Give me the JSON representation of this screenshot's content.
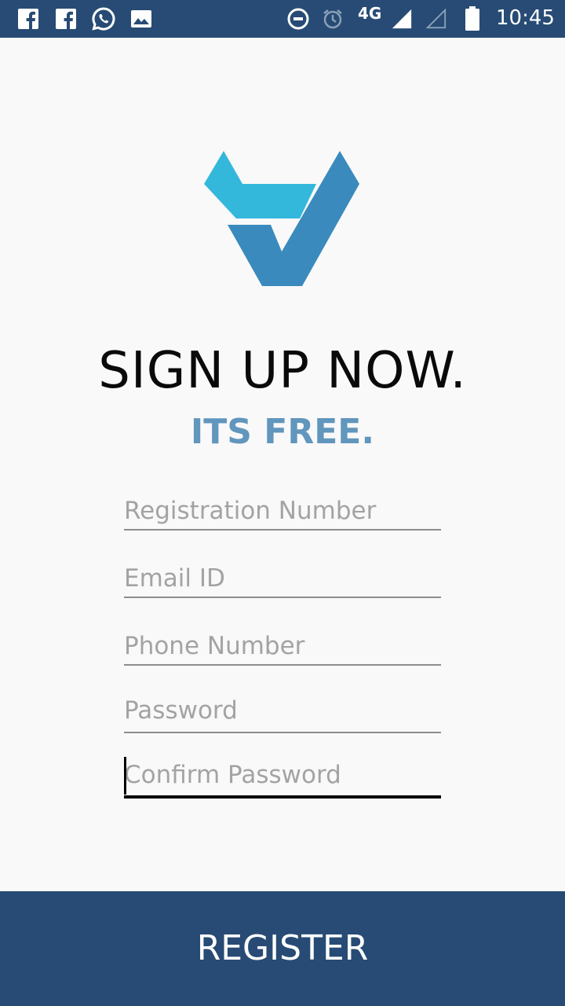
{
  "status_bar": {
    "network": "4G",
    "time": "10:45",
    "notification_icons": [
      "facebook-icon",
      "facebook-icon",
      "whatsapp-icon",
      "gallery-icon"
    ],
    "system_icons": [
      "dnd-icon",
      "alarm-icon",
      "signal-icon",
      "signal-empty-icon",
      "battery-icon"
    ],
    "background": "#274b74"
  },
  "header": {
    "logo_colors": [
      "#33b8dc",
      "#3a8abd"
    ],
    "title": "SIGN UP NOW.",
    "subtitle": "ITS FREE.",
    "subtitle_color": "#6196bd"
  },
  "form": {
    "fields": [
      {
        "placeholder": "Registration Number",
        "value": ""
      },
      {
        "placeholder": "Email ID",
        "value": ""
      },
      {
        "placeholder": "Phone Number",
        "value": ""
      },
      {
        "placeholder": "Password",
        "value": ""
      },
      {
        "placeholder": "Confirm Password",
        "value": ""
      }
    ],
    "focused_field": "Confirm Password"
  },
  "footer": {
    "register_label": "REGISTER",
    "background": "#274b74"
  }
}
